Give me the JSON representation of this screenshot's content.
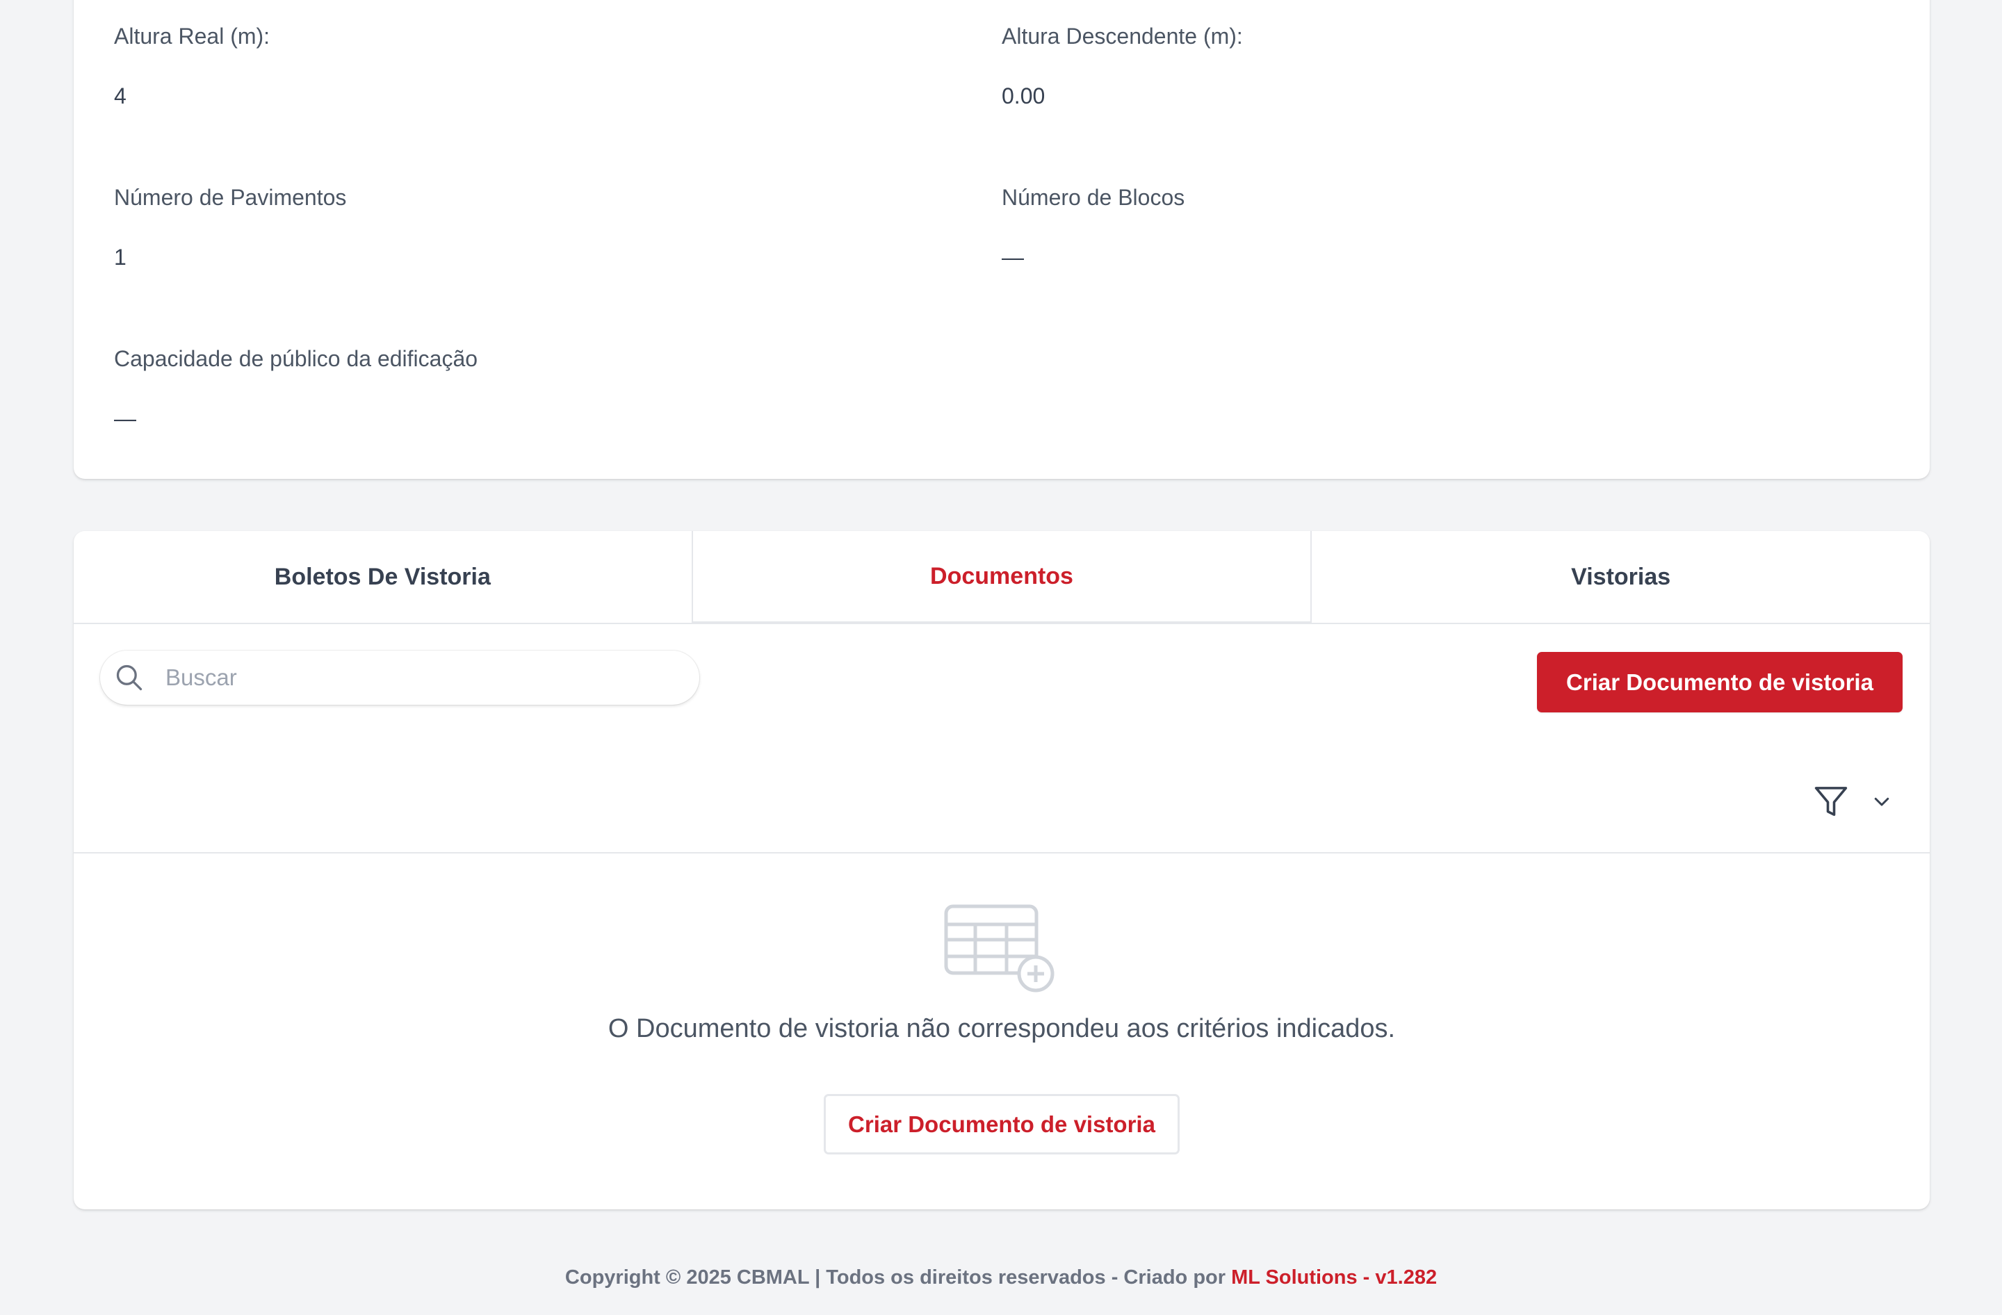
{
  "details": {
    "altura_real": {
      "label": "Altura Real (m):",
      "value": "4"
    },
    "altura_descendente": {
      "label": "Altura Descendente (m):",
      "value": "0.00"
    },
    "numero_pavimentos": {
      "label": "Número de Pavimentos",
      "value": "1"
    },
    "numero_blocos": {
      "label": "Número de Blocos",
      "value": "—"
    },
    "capacidade_publico": {
      "label": "Capacidade de público da edificação",
      "value": "—"
    }
  },
  "tabs": [
    {
      "label": "Boletos De Vistoria",
      "active": false
    },
    {
      "label": "Documentos",
      "active": true
    },
    {
      "label": "Vistorias",
      "active": false
    }
  ],
  "toolbar": {
    "search_placeholder": "Buscar",
    "search_value": "",
    "create_button_label": "Criar Documento de vistoria"
  },
  "empty_state": {
    "message": "O Documento de vistoria não correspondeu aos critérios indicados.",
    "create_button_label": "Criar Documento de vistoria"
  },
  "footer": {
    "text": "Copyright © 2025 CBMAL | Todos os direitos reservados - Criado por ",
    "brand": "ML Solutions - v1.282"
  },
  "colors": {
    "accent": "#cc1f2a",
    "background": "#f3f4f6",
    "card": "#ffffff"
  },
  "icons": {
    "search": "search-icon",
    "filter": "funnel-icon",
    "chevron": "chevron-down-icon",
    "empty": "table-plus-icon"
  }
}
